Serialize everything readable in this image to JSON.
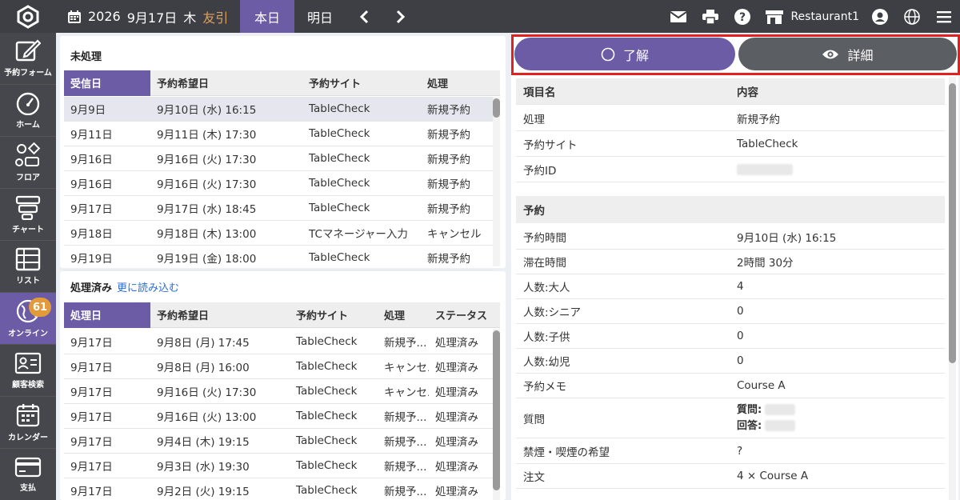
{
  "header": {
    "year": "2026",
    "date": "9月17日",
    "weekday": "木",
    "rokuyo": "友引",
    "tab_today": "本日",
    "tab_tomorrow": "明日",
    "restaurant": "Restaurant1"
  },
  "sidebar": {
    "items": [
      {
        "label": "予約フォーム",
        "icon": "edit-icon"
      },
      {
        "label": "ホーム",
        "icon": "gauge-icon"
      },
      {
        "label": "フロア",
        "icon": "floor-icon"
      },
      {
        "label": "チャート",
        "icon": "chart-icon"
      },
      {
        "label": "リスト",
        "icon": "list-icon"
      },
      {
        "label": "オンライン",
        "icon": "globe-icon",
        "badge": "61"
      },
      {
        "label": "顧客検索",
        "icon": "customer-card-icon"
      },
      {
        "label": "カレンダー",
        "icon": "calendar-icon"
      },
      {
        "label": "支払",
        "icon": "payment-card-icon"
      }
    ]
  },
  "unprocessed": {
    "title": "未処理",
    "headers": [
      "受信日",
      "予約希望日",
      "予約サイト",
      "処理"
    ],
    "rows": [
      [
        "9月9日",
        "9月10日 (水) 16:15",
        "TableCheck",
        "新規予約"
      ],
      [
        "9月11日",
        "9月11日 (木) 17:30",
        "TableCheck",
        "新規予約"
      ],
      [
        "9月16日",
        "9月16日 (火) 17:30",
        "TableCheck",
        "新規予約"
      ],
      [
        "9月16日",
        "9月16日 (火) 17:30",
        "TableCheck",
        "新規予約"
      ],
      [
        "9月17日",
        "9月17日 (水) 18:45",
        "TableCheck",
        "新規予約"
      ],
      [
        "9月18日",
        "9月18日 (木) 13:00",
        "TCマネージャー入力",
        "キャンセル"
      ],
      [
        "9月19日",
        "9月19日 (金) 18:00",
        "TableCheck",
        "新規予約"
      ]
    ]
  },
  "processed": {
    "title": "処理済み",
    "load_more": "更に読み込む",
    "headers": [
      "処理日",
      "予約希望日",
      "予約サイト",
      "処理",
      "ステータス"
    ],
    "rows": [
      [
        "9月17日",
        "9月8日 (月) 17:45",
        "TableCheck",
        "新規予...",
        "処理済み"
      ],
      [
        "9月17日",
        "9月8日 (月) 16:00",
        "TableCheck",
        "キャンセル",
        "処理済み"
      ],
      [
        "9月17日",
        "9月16日 (火) 17:30",
        "TableCheck",
        "キャンセル",
        "処理済み"
      ],
      [
        "9月17日",
        "9月16日 (火) 13:00",
        "TableCheck",
        "新規予...",
        "処理済み"
      ],
      [
        "9月17日",
        "9月4日 (木) 19:15",
        "TableCheck",
        "新規予...",
        "処理済み"
      ],
      [
        "9月17日",
        "9月3日 (水) 19:30",
        "TableCheck",
        "新規予...",
        "処理済み"
      ],
      [
        "9月17日",
        "9月2日 (火) 19:15",
        "TableCheck",
        "新規予...",
        "処理済み"
      ]
    ]
  },
  "actions": {
    "ack": "了解",
    "detail": "詳細"
  },
  "detail": {
    "col_item": "項目名",
    "col_content": "内容",
    "rows_top": [
      [
        "処理",
        "新規予約"
      ],
      [
        "予約サイト",
        "TableCheck"
      ],
      [
        "予約ID",
        ""
      ]
    ],
    "section": "予約",
    "rows_reservation": [
      [
        "予約時間",
        "9月10日 (水) 16:15"
      ],
      [
        "滞在時間",
        "2時間 30分"
      ],
      [
        "人数:大人",
        "4"
      ],
      [
        "人数:シニア",
        "0"
      ],
      [
        "人数:子供",
        "0"
      ],
      [
        "人数:幼児",
        "0"
      ],
      [
        "予約メモ",
        "Course A"
      ]
    ],
    "question_label": "質問",
    "question_q": "質問:",
    "question_a": "回答:",
    "rows_bottom": [
      [
        "禁煙・喫煙の希望",
        "?"
      ],
      [
        "注文",
        "4 × Course A"
      ]
    ]
  }
}
